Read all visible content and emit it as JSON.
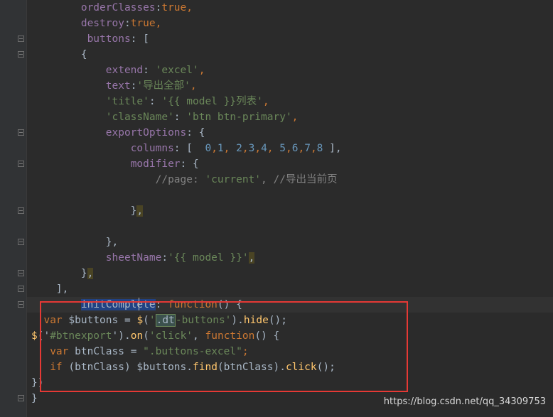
{
  "lines": [
    [
      {
        "t": "        ",
        "c": "plain"
      },
      {
        "t": "orderClasses",
        "c": "prop"
      },
      {
        "t": ":",
        "c": "plain"
      },
      {
        "t": "true",
        "c": "kw"
      },
      {
        "t": ",",
        "c": "kw"
      }
    ],
    [
      {
        "t": "        ",
        "c": "plain"
      },
      {
        "t": "destroy",
        "c": "prop"
      },
      {
        "t": ":",
        "c": "plain"
      },
      {
        "t": "true",
        "c": "kw"
      },
      {
        "t": ",",
        "c": "kw"
      }
    ],
    [
      {
        "t": "         ",
        "c": "plain"
      },
      {
        "t": "buttons",
        "c": "prop"
      },
      {
        "t": ": [",
        "c": "plain"
      }
    ],
    [
      {
        "t": "        {",
        "c": "plain"
      }
    ],
    [
      {
        "t": "            ",
        "c": "plain"
      },
      {
        "t": "extend",
        "c": "prop"
      },
      {
        "t": ": ",
        "c": "plain"
      },
      {
        "t": "'excel'",
        "c": "str"
      },
      {
        "t": ",",
        "c": "kw"
      }
    ],
    [
      {
        "t": "            ",
        "c": "plain"
      },
      {
        "t": "text",
        "c": "prop"
      },
      {
        "t": ":",
        "c": "plain"
      },
      {
        "t": "'导出全部'",
        "c": "str"
      },
      {
        "t": ",",
        "c": "kw"
      }
    ],
    [
      {
        "t": "            ",
        "c": "plain"
      },
      {
        "t": "'title'",
        "c": "str"
      },
      {
        "t": ": ",
        "c": "plain"
      },
      {
        "t": "'{{ model }}列表'",
        "c": "str"
      },
      {
        "t": ",",
        "c": "kw"
      }
    ],
    [
      {
        "t": "            ",
        "c": "plain"
      },
      {
        "t": "'className'",
        "c": "str"
      },
      {
        "t": ": ",
        "c": "plain"
      },
      {
        "t": "'btn btn-primary'",
        "c": "str"
      },
      {
        "t": ",",
        "c": "kw"
      }
    ],
    [
      {
        "t": "            ",
        "c": "plain"
      },
      {
        "t": "exportOptions",
        "c": "prop"
      },
      {
        "t": ": {",
        "c": "plain"
      }
    ],
    [
      {
        "t": "                ",
        "c": "plain"
      },
      {
        "t": "columns",
        "c": "prop"
      },
      {
        "t": ": [  ",
        "c": "plain"
      },
      {
        "t": "0",
        "c": "num"
      },
      {
        "t": ",",
        "c": "kw"
      },
      {
        "t": "1",
        "c": "num"
      },
      {
        "t": ", ",
        "c": "kw"
      },
      {
        "t": "2",
        "c": "num"
      },
      {
        "t": ",",
        "c": "kw"
      },
      {
        "t": "3",
        "c": "num"
      },
      {
        "t": ",",
        "c": "kw"
      },
      {
        "t": "4",
        "c": "num"
      },
      {
        "t": ", ",
        "c": "kw"
      },
      {
        "t": "5",
        "c": "num"
      },
      {
        "t": ",",
        "c": "kw"
      },
      {
        "t": "6",
        "c": "num"
      },
      {
        "t": ",",
        "c": "kw"
      },
      {
        "t": "7",
        "c": "num"
      },
      {
        "t": ",",
        "c": "kw"
      },
      {
        "t": "8",
        "c": "num"
      },
      {
        "t": " ],",
        "c": "plain"
      }
    ],
    [
      {
        "t": "                ",
        "c": "plain"
      },
      {
        "t": "modifier",
        "c": "prop"
      },
      {
        "t": ": {",
        "c": "plain"
      }
    ],
    [
      {
        "t": "                    ",
        "c": "plain"
      },
      {
        "t": "//page: ",
        "c": "cm"
      },
      {
        "t": "'current'",
        "c": "str"
      },
      {
        "t": ", //导出当前页",
        "c": "cm"
      }
    ],
    [
      {
        "t": "",
        "c": "plain"
      }
    ],
    [
      {
        "t": "                }",
        "c": "plain"
      },
      {
        "t": ",",
        "c": "comma-hl"
      }
    ],
    [
      {
        "t": "",
        "c": "plain"
      }
    ],
    [
      {
        "t": "            },",
        "c": "plain"
      }
    ],
    [
      {
        "t": "            ",
        "c": "plain"
      },
      {
        "t": "sheetName",
        "c": "prop"
      },
      {
        "t": ":",
        "c": "plain"
      },
      {
        "t": "'{{ model }}'",
        "c": "str"
      },
      {
        "t": ",",
        "c": "comma-hl"
      }
    ],
    [
      {
        "t": "        }",
        "c": "plain"
      },
      {
        "t": ",",
        "c": "comma-hl"
      }
    ],
    [
      {
        "t": "    ],",
        "c": "plain"
      }
    ],
    [
      {
        "t": "        ",
        "c": "plain"
      },
      {
        "t": "initComplete",
        "c": "sel-hl"
      },
      {
        "t": ": ",
        "c": "plain"
      },
      {
        "t": "function",
        "c": "kw"
      },
      {
        "t": "() {",
        "c": "plain"
      }
    ],
    [
      {
        "t": "  ",
        "c": "plain"
      },
      {
        "t": "var",
        "c": "kw"
      },
      {
        "t": " $buttons = ",
        "c": "plain"
      },
      {
        "t": "$",
        "c": "fn"
      },
      {
        "t": "(",
        "c": "plain"
      },
      {
        "t": "'",
        "c": "str"
      },
      {
        "t": ".dt",
        "c": "match-hl"
      },
      {
        "t": "-buttons'",
        "c": "str"
      },
      {
        "t": ").",
        "c": "plain"
      },
      {
        "t": "hide",
        "c": "fn"
      },
      {
        "t": "();",
        "c": "plain"
      }
    ],
    [
      {
        "t": "$",
        "c": "fn"
      },
      {
        "t": "('",
        "c": "plain"
      },
      {
        "t": "#btnexport",
        "c": "str"
      },
      {
        "t": "').",
        "c": "plain"
      },
      {
        "t": "on",
        "c": "fn"
      },
      {
        "t": "(",
        "c": "plain"
      },
      {
        "t": "'click'",
        "c": "str"
      },
      {
        "t": ", ",
        "c": "plain"
      },
      {
        "t": "function",
        "c": "kw"
      },
      {
        "t": "() {",
        "c": "plain"
      }
    ],
    [
      {
        "t": "   ",
        "c": "plain"
      },
      {
        "t": "var",
        "c": "kw"
      },
      {
        "t": " btnClass = ",
        "c": "plain"
      },
      {
        "t": "\".buttons-excel\"",
        "c": "str"
      },
      {
        "t": ";",
        "c": "kw"
      }
    ],
    [
      {
        "t": "   ",
        "c": "plain"
      },
      {
        "t": "if",
        "c": "kw"
      },
      {
        "t": " (btnClass) $buttons.",
        "c": "plain"
      },
      {
        "t": "find",
        "c": "fn"
      },
      {
        "t": "(btnClass).",
        "c": "plain"
      },
      {
        "t": "click",
        "c": "fn"
      },
      {
        "t": "();",
        "c": "plain"
      }
    ],
    [
      {
        "t": "})",
        "c": "plain"
      }
    ],
    [
      {
        "t": "}",
        "c": "plain"
      }
    ]
  ],
  "watermark": "https://blog.csdn.net/qq_34309753"
}
